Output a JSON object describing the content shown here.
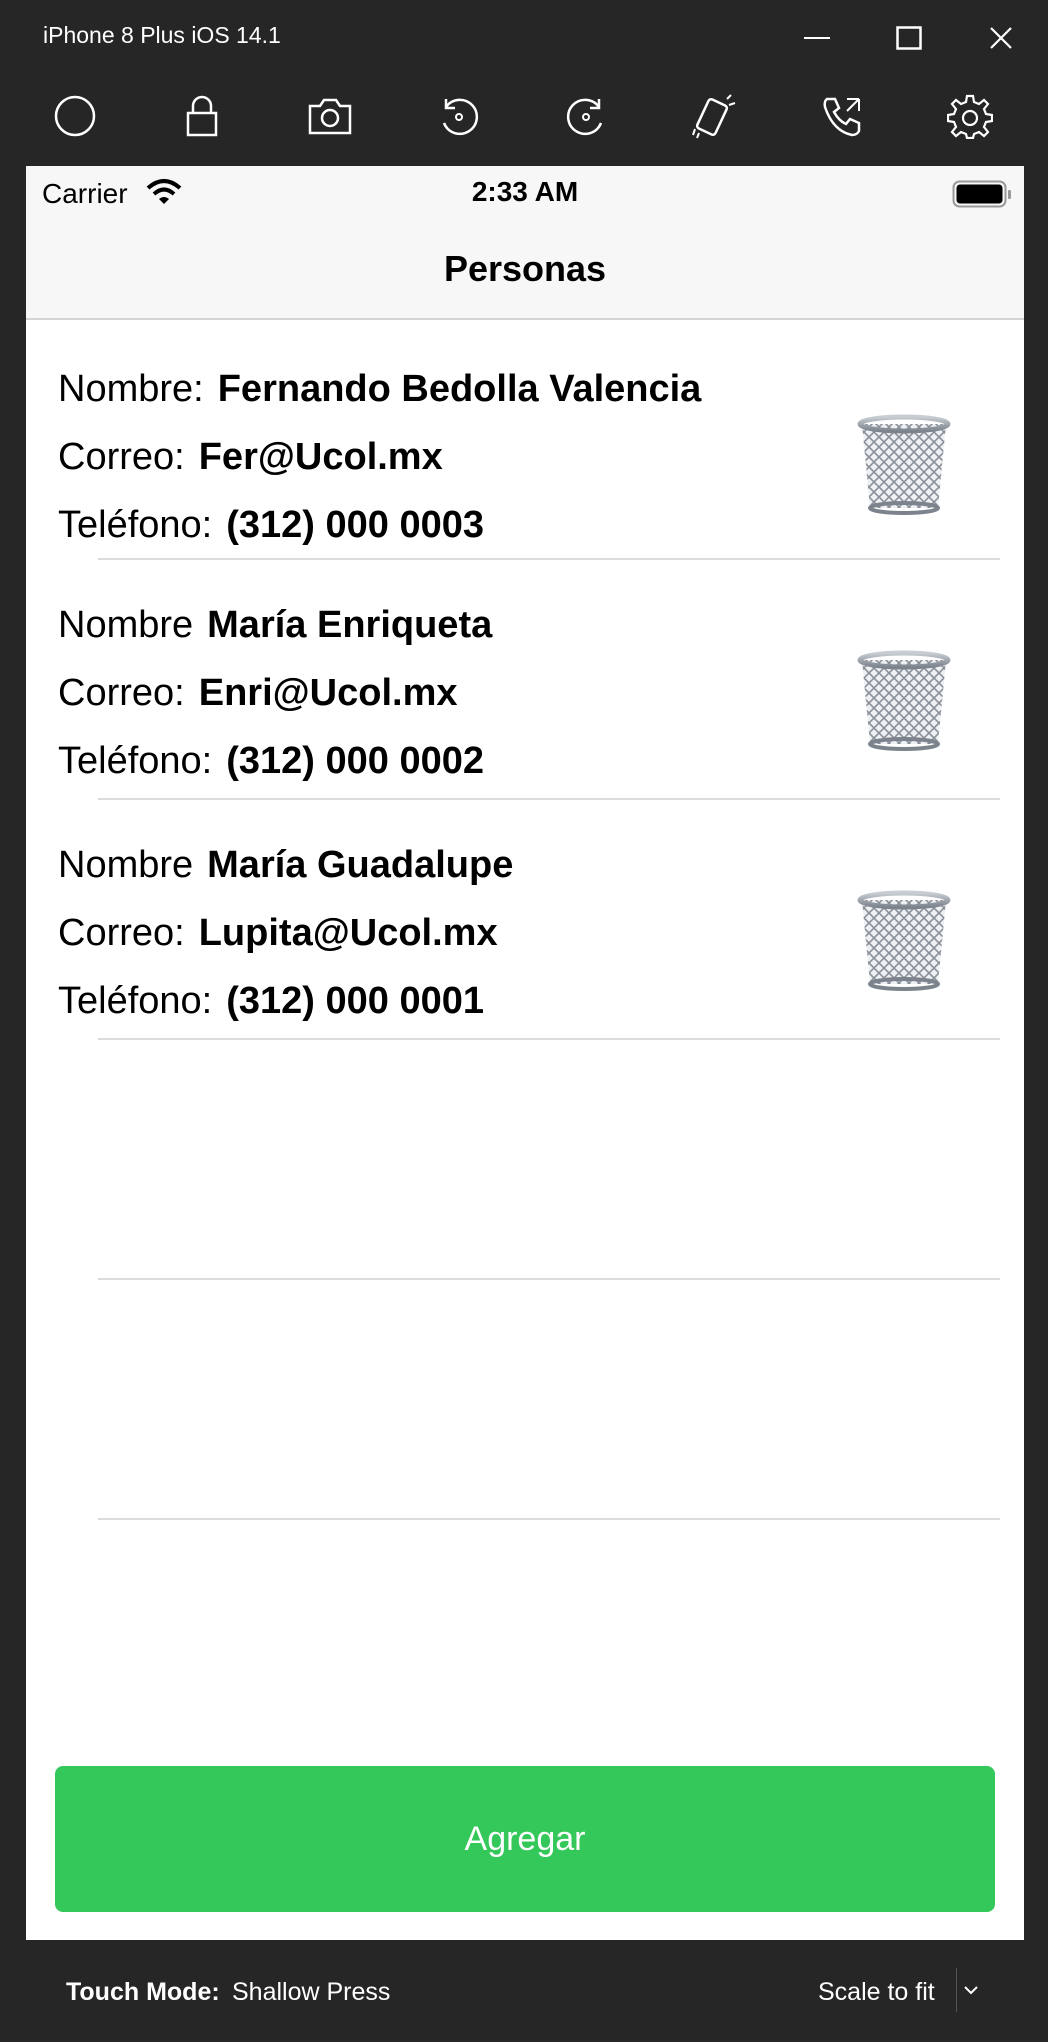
{
  "window": {
    "title": "iPhone 8 Plus iOS 14.1"
  },
  "toolbar": {
    "icons": [
      "home-icon",
      "lock-icon",
      "camera-icon",
      "rotate-left-icon",
      "rotate-right-icon",
      "shake-icon",
      "call-icon",
      "settings-icon"
    ]
  },
  "status_bar": {
    "carrier": "Carrier",
    "time": "2:33 AM"
  },
  "nav": {
    "title": "Personas"
  },
  "people": [
    {
      "name_label": "Nombre:",
      "name": "Fernando Bedolla Valencia",
      "email_label": "Correo:",
      "email": "Fer@Ucol.mx",
      "phone_label": "Teléfono:",
      "phone": "(312) 000 0003"
    },
    {
      "name_label": "Nombre",
      "name": "María Enriqueta",
      "email_label": "Correo:",
      "email": "Enri@Ucol.mx",
      "phone_label": "Teléfono:",
      "phone": "(312) 000 0002"
    },
    {
      "name_label": "Nombre",
      "name": "María Guadalupe",
      "email_label": "Correo:",
      "email": "Lupita@Ucol.mx",
      "phone_label": "Teléfono:",
      "phone": "(312) 000 0001"
    }
  ],
  "add_button": {
    "label": "Agregar",
    "color": "#34c759"
  },
  "bottom_bar": {
    "touch_mode_label": "Touch Mode:",
    "touch_mode_value": "Shallow Press",
    "scale_label": "Scale to fit"
  }
}
